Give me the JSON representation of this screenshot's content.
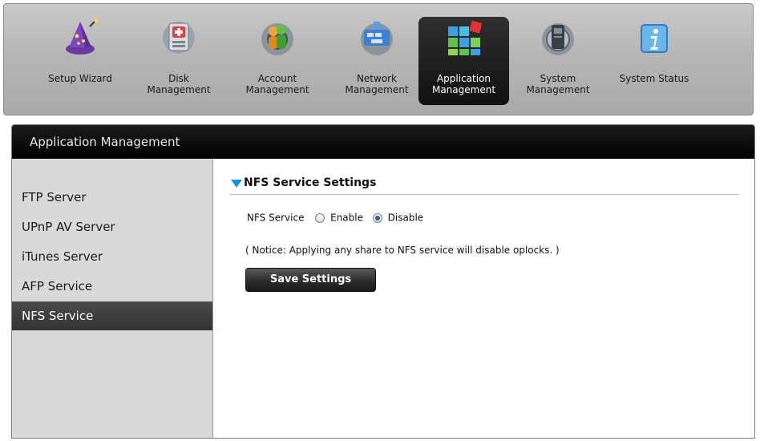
{
  "toolbar": {
    "items": [
      {
        "label": "Setup Wizard",
        "icon": "wizard-icon"
      },
      {
        "label": "Disk\nManagement",
        "icon": "disk-icon"
      },
      {
        "label": "Account\nManagement",
        "icon": "account-icon"
      },
      {
        "label": "Network\nManagement",
        "icon": "network-icon"
      },
      {
        "label": "Application\nManagement",
        "icon": "application-icon",
        "active": true
      },
      {
        "label": "System\nManagement",
        "icon": "system-icon"
      },
      {
        "label": "System Status",
        "icon": "info-icon"
      }
    ]
  },
  "panel": {
    "title": "Application Management"
  },
  "sidebar": {
    "items": [
      {
        "label": "FTP Server"
      },
      {
        "label": "UPnP AV Server"
      },
      {
        "label": "iTunes Server"
      },
      {
        "label": "AFP Service"
      },
      {
        "label": "NFS Service",
        "active": true
      }
    ]
  },
  "nfs": {
    "section_title": "NFS Service Settings",
    "service_label": "NFS Service",
    "enable_label": "Enable",
    "disable_label": "Disable",
    "selected": "Disable",
    "notice": "( Notice: Applying any share to NFS service will disable oplocks. )",
    "save_label": "Save Settings"
  },
  "colors": {
    "accent": "#1a8fe0",
    "header": "#000000",
    "active_item": "#3c3c3c"
  }
}
